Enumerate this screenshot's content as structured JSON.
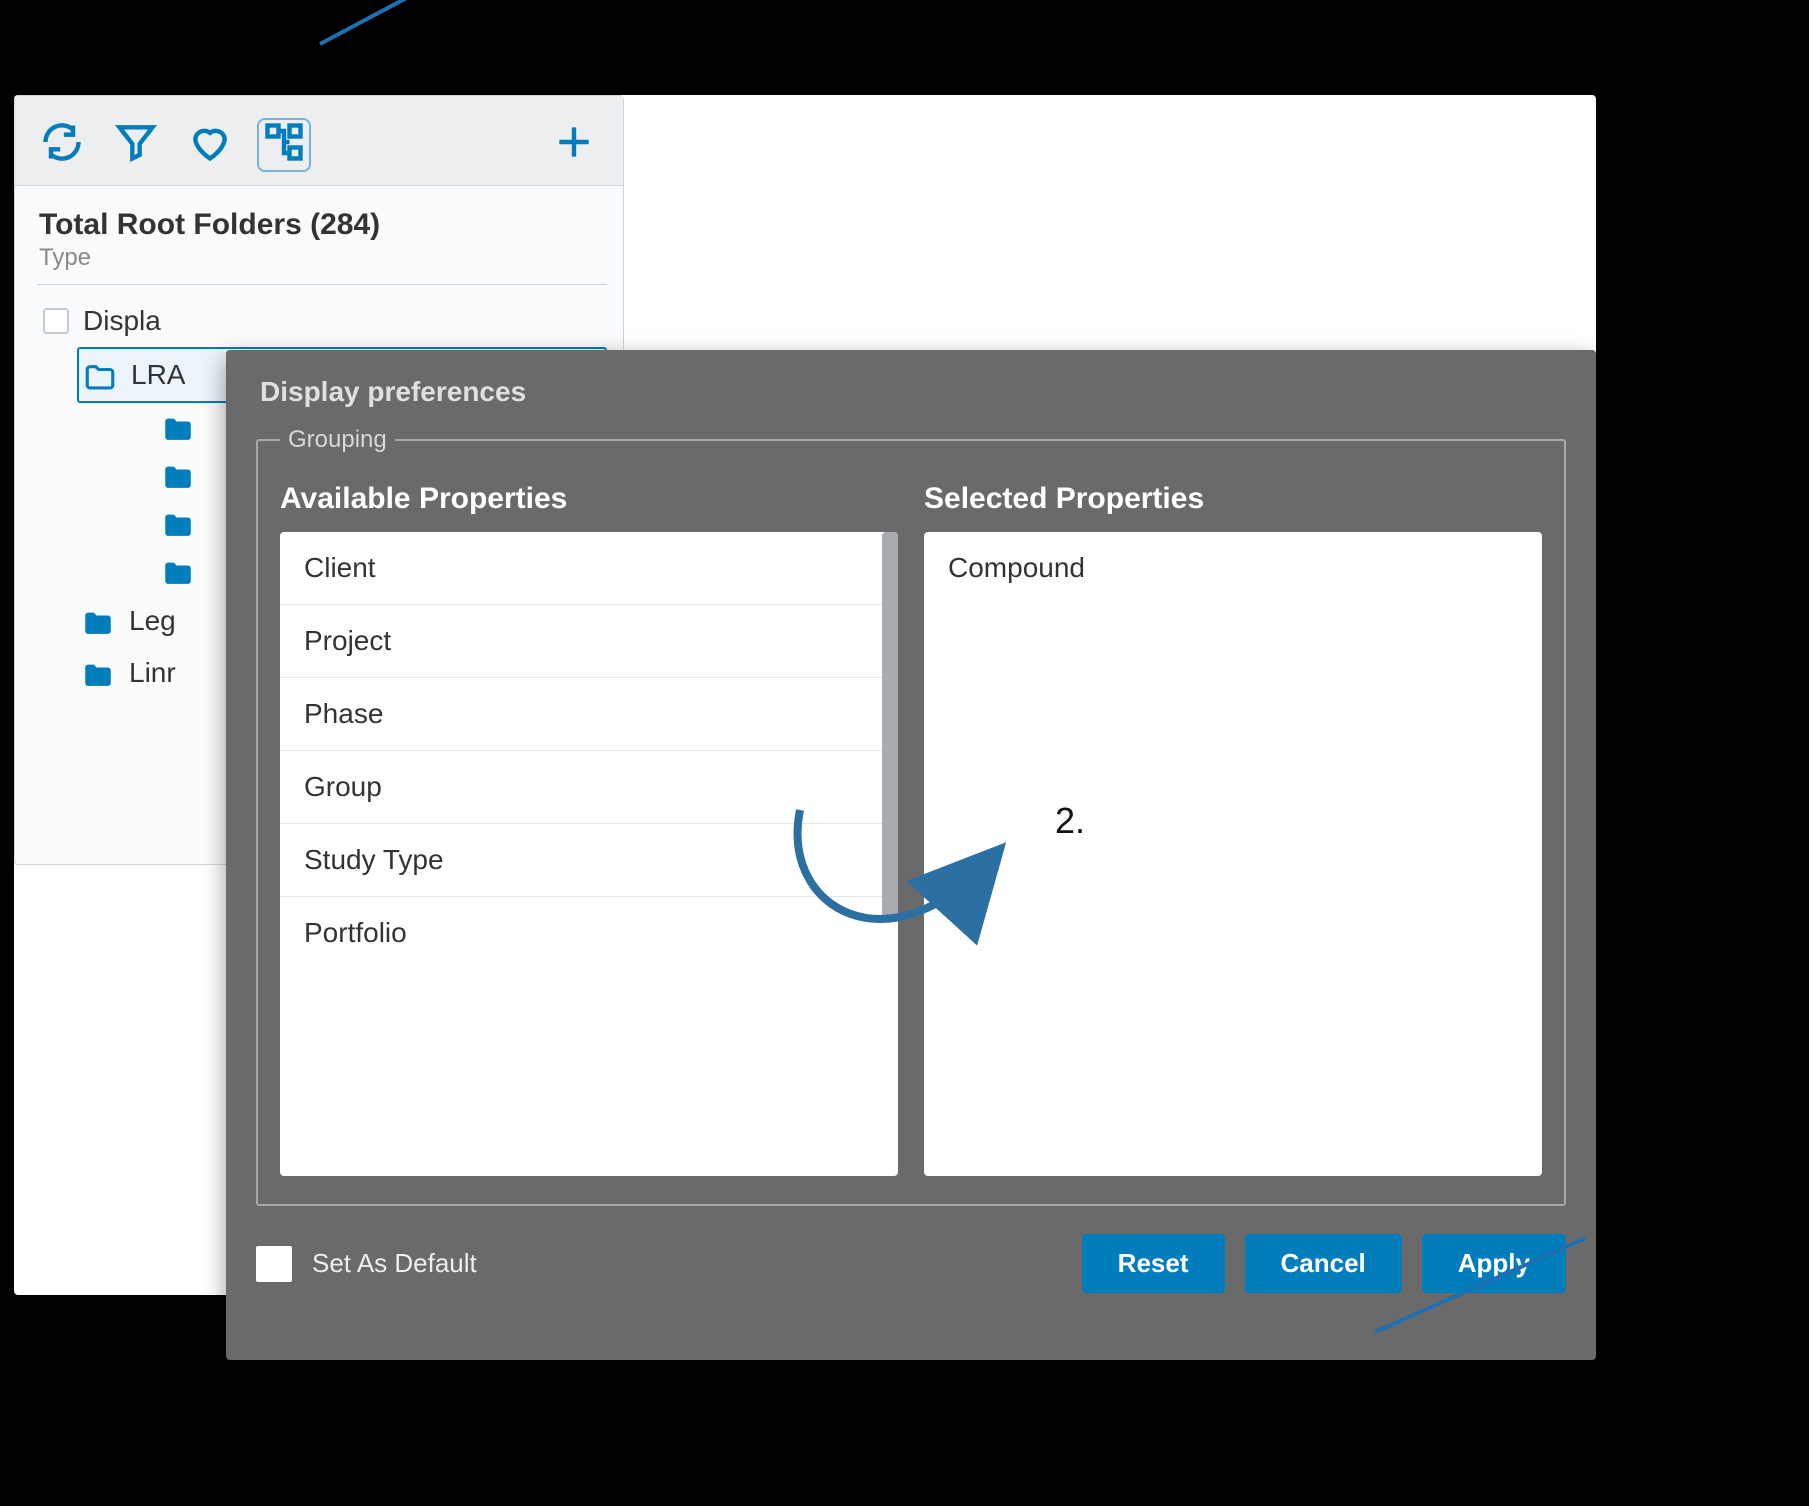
{
  "toolbar": {
    "refresh_tip": "Refresh",
    "filter_tip": "Filter",
    "fav_tip": "Favorites",
    "grouping_tip": "Grouping",
    "add_tip": "Add"
  },
  "tree": {
    "summary": "Total Root Folders (284)",
    "subtitle": "Type",
    "nodes": [
      {
        "label": "Displa",
        "lvl": 1,
        "hasChk": true
      },
      {
        "label": "LRA",
        "lvl": 2,
        "selected": true,
        "outline": true
      },
      {
        "label": "",
        "lvl": 3,
        "solid": true
      },
      {
        "label": "",
        "lvl": 3,
        "solid": true
      },
      {
        "label": "",
        "lvl": 3,
        "solid": true
      },
      {
        "label": "",
        "lvl": 3,
        "solid": true
      },
      {
        "label": "Leg",
        "lvl": 2,
        "solid": true
      },
      {
        "label": "Linr",
        "lvl": 2,
        "solid": true
      }
    ]
  },
  "dialog": {
    "title": "Display preferences",
    "group_legend": "Grouping",
    "available_label": "Available Properties",
    "selected_label": "Selected Properties",
    "available": [
      "Client",
      "Project",
      "Phase",
      "Group",
      "Study Type",
      "Portfolio"
    ],
    "selected": [
      "Compound"
    ],
    "set_default_label": "Set As Default",
    "reset_label": "Reset",
    "cancel_label": "Cancel",
    "apply_label": "Apply"
  },
  "annotation": {
    "step": "2."
  }
}
